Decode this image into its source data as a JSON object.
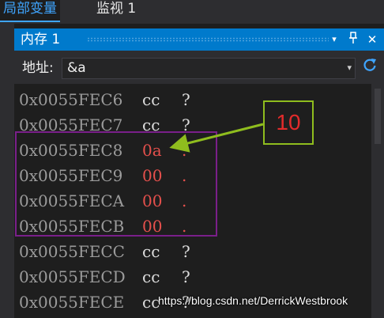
{
  "tabs": [
    {
      "label": "局部变量",
      "active": true
    },
    {
      "label": "监视 1",
      "active": false
    }
  ],
  "panel": {
    "title": "内存 1",
    "buttons": {
      "dropdown": "▾",
      "pin": "📌",
      "close": "✕"
    }
  },
  "address": {
    "label": "地址:",
    "value": "&a",
    "dropdown_icon": "▾",
    "refresh_icon": "refresh-icon"
  },
  "rows": [
    {
      "addr": "0x0055FEC6",
      "hex": "cc",
      "chr": "?",
      "changed": false
    },
    {
      "addr": "0x0055FEC7",
      "hex": "cc",
      "chr": "?",
      "changed": false
    },
    {
      "addr": "0x0055FEC8",
      "hex": "0a",
      "chr": ".",
      "changed": true
    },
    {
      "addr": "0x0055FEC9",
      "hex": "00",
      "chr": ".",
      "changed": true
    },
    {
      "addr": "0x0055FECA",
      "hex": "00",
      "chr": ".",
      "changed": true
    },
    {
      "addr": "0x0055FECB",
      "hex": "00",
      "chr": ".",
      "changed": true
    },
    {
      "addr": "0x0055FECC",
      "hex": "cc",
      "chr": "?",
      "changed": false
    },
    {
      "addr": "0x0055FECD",
      "hex": "cc",
      "chr": "?",
      "changed": false
    },
    {
      "addr": "0x0055FECE",
      "hex": "cc",
      "chr": "?",
      "changed": false
    }
  ],
  "annotation": {
    "label": "10"
  },
  "watermark": "https://blog.csdn.net/DerrickWestbrook",
  "colors": {
    "accent": "#007acc",
    "changed_value": "#e5504c",
    "highlight_box": "#7a1f8a",
    "annotation_box": "#8fbd1e"
  }
}
